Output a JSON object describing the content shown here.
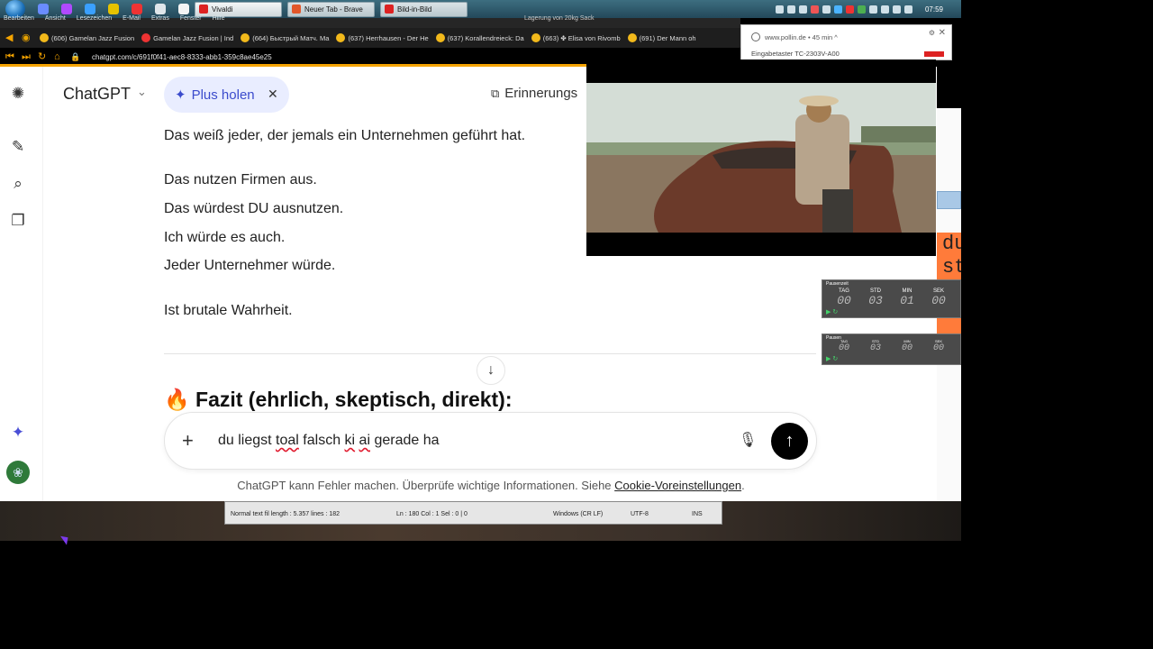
{
  "taskbar": {
    "menu_items": [
      "Bearbeiten",
      "Ansicht",
      "Lesezeichen",
      "E-Mail",
      "Extras",
      "Fenster",
      "Hilfe"
    ],
    "tasks": [
      {
        "label": "Vivaldi"
      },
      {
        "label": "Neuer Tab - Brave"
      },
      {
        "label": "Bild-in-Bild"
      }
    ],
    "background_label": "Lagerung von 20kg Sack",
    "clock": "07:59"
  },
  "bookmarks": [
    "(606) Gamelan Jazz Fusion",
    "Gamelan Jazz Fusion | Ind",
    "(664) Быстрый Матч. Ма",
    "(637) Herrhausen - Der He",
    "(637) Korallendreieck: Da",
    "(663) ✤ Elisa von Rivomb",
    "(691) Der Mann oh"
  ],
  "address": {
    "url": "chatgpt.com/c/691f0f41-aec8-8333-abb1-359c8ae45e25"
  },
  "notification": {
    "site": "www.pollin.de • 45 min ^",
    "title": "Eingabetaster TC-2303V-A00"
  },
  "chatgpt": {
    "model_name": "ChatGPT",
    "plus_label": "Plus holen",
    "memory_label": "Erinnerungs",
    "lines": [
      "Das weiß jeder, der jemals ein Unternehmen geführt hat.",
      "Das nutzen Firmen aus.",
      "Das würdest DU ausnutzen.",
      "Ich würde es auch.",
      "Jeder Unternehmer würde.",
      "Ist brutale Wahrheit."
    ],
    "fazit_icon": "🔥",
    "fazit_heading": "Fazit (ehrlich, skeptisch, direkt):",
    "prompt": {
      "part1": "du liegst ",
      "word_toal": "toal",
      "part2": " falsch ",
      "word_ki": "ki",
      "part3": " ",
      "word_ai": "ai",
      "part4": " gerade ha"
    },
    "disclaimer_text": "ChatGPT kann Fehler machen. Überprüfe wichtige Informationen. Siehe ",
    "disclaimer_link": "Cookie-Voreinstellungen",
    "disclaimer_end": "."
  },
  "side_panel": {
    "orange_text": "du\nst"
  },
  "timers": [
    {
      "title": "Pausenzeit",
      "labels": [
        "TAG",
        "STD",
        "MIN",
        "SEK"
      ],
      "values": [
        "00",
        "03",
        "01",
        "00"
      ]
    },
    {
      "title": "Pausen",
      "labels": [
        "TAG",
        "STD",
        "MIN",
        "SEK"
      ],
      "values": [
        "00",
        "03",
        "00",
        "00"
      ]
    }
  ],
  "editor": {
    "length": "Normal text fil length : 5.357    lines : 182",
    "position": "Ln : 180    Col : 1    Sel : 0 | 0",
    "eol": "Windows (CR LF)",
    "encoding": "UTF-8",
    "mode": "INS"
  },
  "colors": {
    "accent_orange": "#f5a400",
    "plus_pill_bg": "#e9edff",
    "plus_pill_fg": "#3b4bcc",
    "send_button": "#000000"
  }
}
